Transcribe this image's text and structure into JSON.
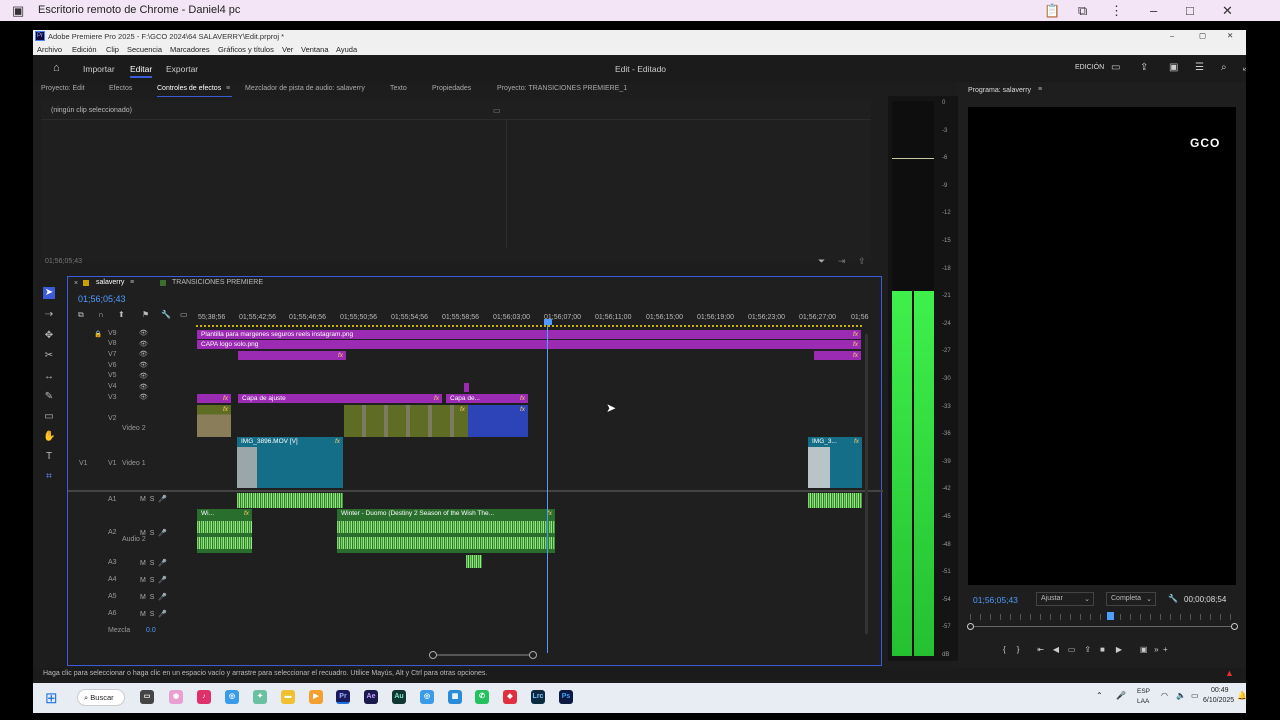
{
  "remote": {
    "title": "Escritorio remoto de Chrome - Daniel4 pc"
  },
  "app": {
    "title": "Adobe Premiere Pro 2025 - F:\\GCO 2024\\64 SALAVERRY\\Edit.prproj *",
    "menu": [
      "Archivo",
      "Edición",
      "Clip",
      "Secuencia",
      "Marcadores",
      "Gráficos y títulos",
      "Ver",
      "Ventana",
      "Ayuda"
    ],
    "header": {
      "import": "Importar",
      "edit": "Editar",
      "export": "Exportar",
      "center": "Edit - Editado",
      "workspace": "EDICIÓN"
    }
  },
  "panels": {
    "tabs": [
      "Proyecto: Edit",
      "Efectos",
      "Controles de efectos",
      "Mezclador de pista de audio: salaverry",
      "Texto",
      "Propiedades",
      "Proyecto: TRANSICIONES PREMIERE_1"
    ],
    "no_clip": "(ningún clip seleccionado)",
    "effects_time": "01;56;05;43"
  },
  "timeline": {
    "tabs": [
      "salaverry",
      "TRANSICIONES PREMIERE"
    ],
    "timecode": "01;56;05;43",
    "ruler": [
      "55;38;56",
      "01;55;42;56",
      "01;55;46;56",
      "01;55;50;56",
      "01;55;54;56",
      "01;55;58;56",
      "01;56;03;00",
      "01;56;07;00",
      "01;56;11;00",
      "01;56;15;00",
      "01;56;19;00",
      "01;56;23;00",
      "01;56;27;00",
      "01;56"
    ],
    "video_tracks": [
      "V9",
      "V8",
      "V7",
      "V6",
      "V5",
      "V4",
      "V3",
      "V2",
      "V1"
    ],
    "v2_name": "Video 2",
    "v1_name": "Video 1",
    "audio_tracks": [
      "A1",
      "A2",
      "A3",
      "A4",
      "A5",
      "A6"
    ],
    "a2_name": "Audio 2",
    "mix_label": "Mezcla",
    "mix_value": "0.0",
    "clips": {
      "plantilla": "Plantilla para margenes seguros reels instagram.png",
      "capa_logo": "CAPA logo solo.png",
      "capa_ajuste": "Capa de ajuste",
      "capa_de": "Capa de...",
      "img3896": "IMG_3896.MOV [V]",
      "img3": "IMG_3...",
      "wi": "Wi...",
      "winter": "Winter - Duomo (Destiny 2 Season of the Wish The..."
    },
    "fx": "fx"
  },
  "meter": {
    "scale": [
      "0",
      "-3",
      "-6",
      "-9",
      "-12",
      "-15",
      "-18",
      "-21",
      "-24",
      "-27",
      "-30",
      "-33",
      "-36",
      "-39",
      "-42",
      "-45",
      "-48",
      "-51",
      "-54",
      "-57",
      "dB"
    ]
  },
  "program": {
    "title": "Programa: salaverry",
    "watermark": "GCO",
    "timecode": "01;56;05;43",
    "fit": "Ajustar",
    "quality": "Completa",
    "duration": "00;00;08;54"
  },
  "status": {
    "hint": "Haga clic para seleccionar o haga clic en un espacio vacío y arrastre para seleccionar el recuadro. Utilice Mayús, Alt y Ctrl para otras opciones."
  },
  "taskbar": {
    "search": "Buscar",
    "lang": "ESP",
    "lang2": "LAA",
    "time": "00:49",
    "date": "6/10/2025",
    "apps": [
      "Pr",
      "Ae",
      "Au",
      "Lrc",
      "Ps"
    ]
  },
  "colors": {
    "accent": "#3b5bd8",
    "magenta_clip": "#9b2bb2",
    "video_clip": "#156e87",
    "audio_clip": "#2a6e2e"
  }
}
